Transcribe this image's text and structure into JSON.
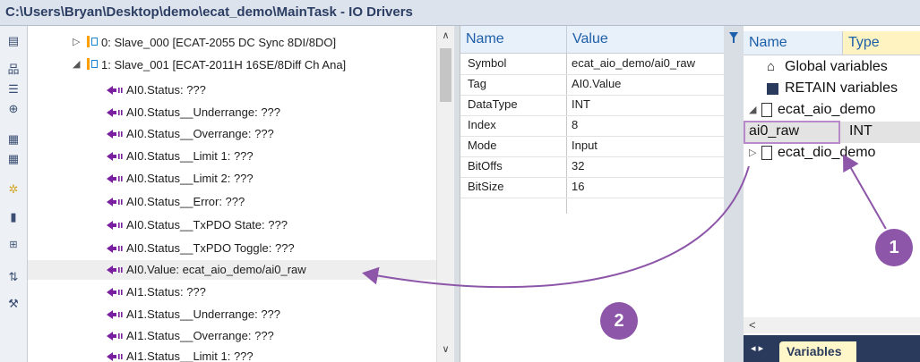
{
  "window": {
    "title": "C:\\Users\\Bryan\\Desktop\\demo\\ecat_demo\\MainTask - IO Drivers"
  },
  "toolbar": {
    "icons": [
      "properties-icon",
      "network-icon",
      "variable-list-icon",
      "add-device-icon",
      "grid-icon",
      "grid-edit-icon",
      "star-icon",
      "import-icon",
      "expand-icon",
      "sort-icon",
      "tools-icon"
    ]
  },
  "tree": {
    "rows": [
      {
        "label": "0: Slave_000 [ECAT-2055 DC Sync 8DI/8DO]",
        "expander": "▷",
        "kind": "device"
      },
      {
        "label": "1: Slave_001 [ECAT-2011H 16SE/8Diff Ch Ana]",
        "expander": "◢",
        "kind": "device"
      },
      {
        "label": "AI0.Status: ???",
        "kind": "input"
      },
      {
        "label": "AI0.Status__Underrange: ???",
        "kind": "input"
      },
      {
        "label": "AI0.Status__Overrange: ???",
        "kind": "input"
      },
      {
        "label": "AI0.Status__Limit 1: ???",
        "kind": "input"
      },
      {
        "label": "AI0.Status__Limit 2: ???",
        "kind": "input"
      },
      {
        "label": "AI0.Status__Error: ???",
        "kind": "input"
      },
      {
        "label": "AI0.Status__TxPDO State: ???",
        "kind": "input"
      },
      {
        "label": "AI0.Status__TxPDO Toggle: ???",
        "kind": "input"
      },
      {
        "label": "AI0.Value: ecat_aio_demo/ai0_raw",
        "kind": "input",
        "selected": true
      },
      {
        "label": "AI1.Status: ???",
        "kind": "input"
      },
      {
        "label": "AI1.Status__Underrange: ???",
        "kind": "input"
      },
      {
        "label": "AI1.Status__Overrange: ???",
        "kind": "input"
      },
      {
        "label": "AI1.Status__Limit 1: ???",
        "kind": "input"
      }
    ]
  },
  "properties": {
    "headers": {
      "name": "Name",
      "value": "Value"
    },
    "rows": [
      {
        "name": "Symbol",
        "value": "ecat_aio_demo/ai0_raw"
      },
      {
        "name": "Tag",
        "value": "AI0.Value"
      },
      {
        "name": "DataType",
        "value": "INT"
      },
      {
        "name": "Index",
        "value": "8"
      },
      {
        "name": "Mode",
        "value": "Input"
      },
      {
        "name": "BitOffs",
        "value": "32"
      },
      {
        "name": "BitSize",
        "value": "16"
      }
    ]
  },
  "variables": {
    "headers": {
      "name": "Name",
      "type": "Type"
    },
    "rows": [
      {
        "label": "Global variables",
        "icon": "home-icon"
      },
      {
        "label": "RETAIN variables",
        "icon": "save-icon"
      },
      {
        "label": "ecat_aio_demo",
        "icon": "file-icon",
        "expander": "◢"
      },
      {
        "label": "ai0_raw",
        "type": "INT",
        "highlight": true
      },
      {
        "label": "ecat_dio_demo",
        "icon": "file-icon",
        "expander": "▷"
      }
    ],
    "tab_label": "Variables",
    "nav": "◂ ▸"
  },
  "callouts": [
    {
      "label": "1"
    },
    {
      "label": "2"
    }
  ],
  "colors": {
    "accent": "#8d56a8",
    "header_text": "#1d5fa8",
    "input_arrow": "#7a1fa0"
  }
}
